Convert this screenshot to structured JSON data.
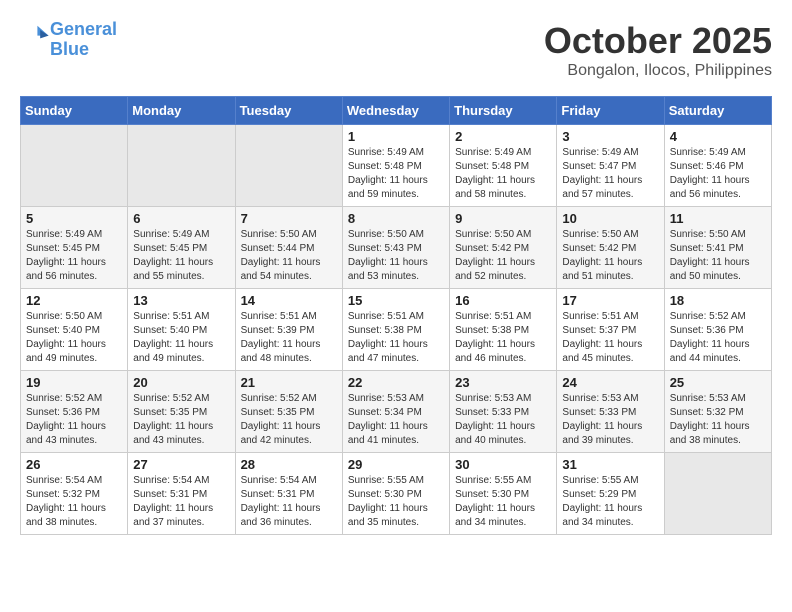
{
  "header": {
    "logo_line1": "General",
    "logo_line2": "Blue",
    "month": "October 2025",
    "location": "Bongalon, Ilocos, Philippines"
  },
  "weekdays": [
    "Sunday",
    "Monday",
    "Tuesday",
    "Wednesday",
    "Thursday",
    "Friday",
    "Saturday"
  ],
  "weeks": [
    [
      {
        "day": "",
        "info": ""
      },
      {
        "day": "",
        "info": ""
      },
      {
        "day": "",
        "info": ""
      },
      {
        "day": "1",
        "info": "Sunrise: 5:49 AM\nSunset: 5:48 PM\nDaylight: 11 hours\nand 59 minutes."
      },
      {
        "day": "2",
        "info": "Sunrise: 5:49 AM\nSunset: 5:48 PM\nDaylight: 11 hours\nand 58 minutes."
      },
      {
        "day": "3",
        "info": "Sunrise: 5:49 AM\nSunset: 5:47 PM\nDaylight: 11 hours\nand 57 minutes."
      },
      {
        "day": "4",
        "info": "Sunrise: 5:49 AM\nSunset: 5:46 PM\nDaylight: 11 hours\nand 56 minutes."
      }
    ],
    [
      {
        "day": "5",
        "info": "Sunrise: 5:49 AM\nSunset: 5:45 PM\nDaylight: 11 hours\nand 56 minutes."
      },
      {
        "day": "6",
        "info": "Sunrise: 5:49 AM\nSunset: 5:45 PM\nDaylight: 11 hours\nand 55 minutes."
      },
      {
        "day": "7",
        "info": "Sunrise: 5:50 AM\nSunset: 5:44 PM\nDaylight: 11 hours\nand 54 minutes."
      },
      {
        "day": "8",
        "info": "Sunrise: 5:50 AM\nSunset: 5:43 PM\nDaylight: 11 hours\nand 53 minutes."
      },
      {
        "day": "9",
        "info": "Sunrise: 5:50 AM\nSunset: 5:42 PM\nDaylight: 11 hours\nand 52 minutes."
      },
      {
        "day": "10",
        "info": "Sunrise: 5:50 AM\nSunset: 5:42 PM\nDaylight: 11 hours\nand 51 minutes."
      },
      {
        "day": "11",
        "info": "Sunrise: 5:50 AM\nSunset: 5:41 PM\nDaylight: 11 hours\nand 50 minutes."
      }
    ],
    [
      {
        "day": "12",
        "info": "Sunrise: 5:50 AM\nSunset: 5:40 PM\nDaylight: 11 hours\nand 49 minutes."
      },
      {
        "day": "13",
        "info": "Sunrise: 5:51 AM\nSunset: 5:40 PM\nDaylight: 11 hours\nand 49 minutes."
      },
      {
        "day": "14",
        "info": "Sunrise: 5:51 AM\nSunset: 5:39 PM\nDaylight: 11 hours\nand 48 minutes."
      },
      {
        "day": "15",
        "info": "Sunrise: 5:51 AM\nSunset: 5:38 PM\nDaylight: 11 hours\nand 47 minutes."
      },
      {
        "day": "16",
        "info": "Sunrise: 5:51 AM\nSunset: 5:38 PM\nDaylight: 11 hours\nand 46 minutes."
      },
      {
        "day": "17",
        "info": "Sunrise: 5:51 AM\nSunset: 5:37 PM\nDaylight: 11 hours\nand 45 minutes."
      },
      {
        "day": "18",
        "info": "Sunrise: 5:52 AM\nSunset: 5:36 PM\nDaylight: 11 hours\nand 44 minutes."
      }
    ],
    [
      {
        "day": "19",
        "info": "Sunrise: 5:52 AM\nSunset: 5:36 PM\nDaylight: 11 hours\nand 43 minutes."
      },
      {
        "day": "20",
        "info": "Sunrise: 5:52 AM\nSunset: 5:35 PM\nDaylight: 11 hours\nand 43 minutes."
      },
      {
        "day": "21",
        "info": "Sunrise: 5:52 AM\nSunset: 5:35 PM\nDaylight: 11 hours\nand 42 minutes."
      },
      {
        "day": "22",
        "info": "Sunrise: 5:53 AM\nSunset: 5:34 PM\nDaylight: 11 hours\nand 41 minutes."
      },
      {
        "day": "23",
        "info": "Sunrise: 5:53 AM\nSunset: 5:33 PM\nDaylight: 11 hours\nand 40 minutes."
      },
      {
        "day": "24",
        "info": "Sunrise: 5:53 AM\nSunset: 5:33 PM\nDaylight: 11 hours\nand 39 minutes."
      },
      {
        "day": "25",
        "info": "Sunrise: 5:53 AM\nSunset: 5:32 PM\nDaylight: 11 hours\nand 38 minutes."
      }
    ],
    [
      {
        "day": "26",
        "info": "Sunrise: 5:54 AM\nSunset: 5:32 PM\nDaylight: 11 hours\nand 38 minutes."
      },
      {
        "day": "27",
        "info": "Sunrise: 5:54 AM\nSunset: 5:31 PM\nDaylight: 11 hours\nand 37 minutes."
      },
      {
        "day": "28",
        "info": "Sunrise: 5:54 AM\nSunset: 5:31 PM\nDaylight: 11 hours\nand 36 minutes."
      },
      {
        "day": "29",
        "info": "Sunrise: 5:55 AM\nSunset: 5:30 PM\nDaylight: 11 hours\nand 35 minutes."
      },
      {
        "day": "30",
        "info": "Sunrise: 5:55 AM\nSunset: 5:30 PM\nDaylight: 11 hours\nand 34 minutes."
      },
      {
        "day": "31",
        "info": "Sunrise: 5:55 AM\nSunset: 5:29 PM\nDaylight: 11 hours\nand 34 minutes."
      },
      {
        "day": "",
        "info": ""
      }
    ]
  ]
}
